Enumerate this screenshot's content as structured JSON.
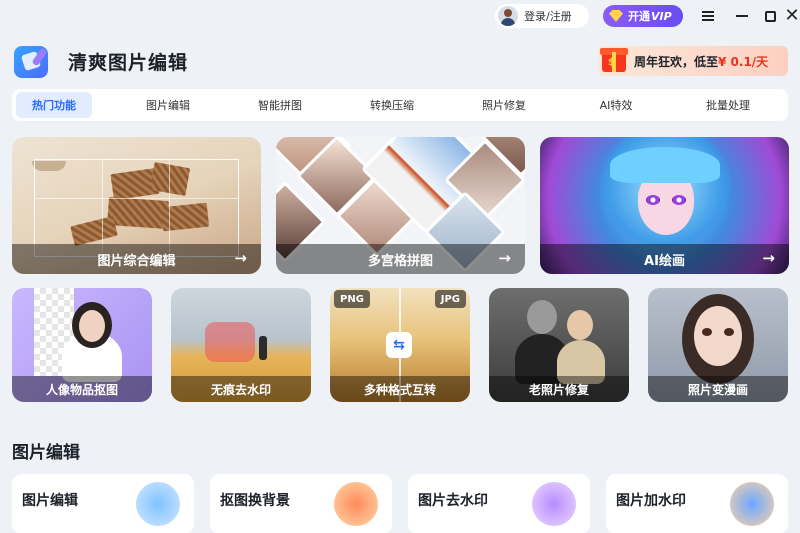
{
  "titlebar": {
    "login_label": "登录/注册",
    "vip_label": "开通",
    "vip_suffix": "VIP",
    "menu_icon": "menu-icon",
    "minimize_icon": "minimize-icon",
    "maximize_icon": "maximize-icon",
    "close_icon": "close-icon"
  },
  "header": {
    "app_name": "清爽图片编辑",
    "promo_text": "周年狂欢，低至",
    "promo_price": "¥ 0.1/天"
  },
  "tabs": [
    {
      "label": "热门功能",
      "active": true
    },
    {
      "label": "图片编辑"
    },
    {
      "label": "智能拼图"
    },
    {
      "label": "转换压缩"
    },
    {
      "label": "照片修复"
    },
    {
      "label": "AI特效"
    },
    {
      "label": "批量处理"
    }
  ],
  "feature_cards": [
    {
      "label": "图片综合编辑",
      "arrow": "→"
    },
    {
      "label": "多宫格拼图",
      "arrow": "→"
    },
    {
      "label": "AI绘画",
      "arrow": "→"
    }
  ],
  "tool_cards": [
    {
      "label": "人像物品抠图"
    },
    {
      "label": "无痕去水印"
    },
    {
      "label": "多种格式互转",
      "from_format": "PNG",
      "to_format": "JPG",
      "swap": "⇆"
    },
    {
      "label": "老照片修复"
    },
    {
      "label": "照片变漫画"
    }
  ],
  "section": {
    "title": "图片编辑",
    "items": [
      {
        "label": "图片编辑"
      },
      {
        "label": "抠图换背景"
      },
      {
        "label": "图片去水印"
      },
      {
        "label": "图片加水印"
      }
    ]
  },
  "colors": {
    "accent": "#2c6bff",
    "vip_start": "#8a5cf6",
    "promo_red": "#e8321c",
    "background": "#eef1f6"
  }
}
